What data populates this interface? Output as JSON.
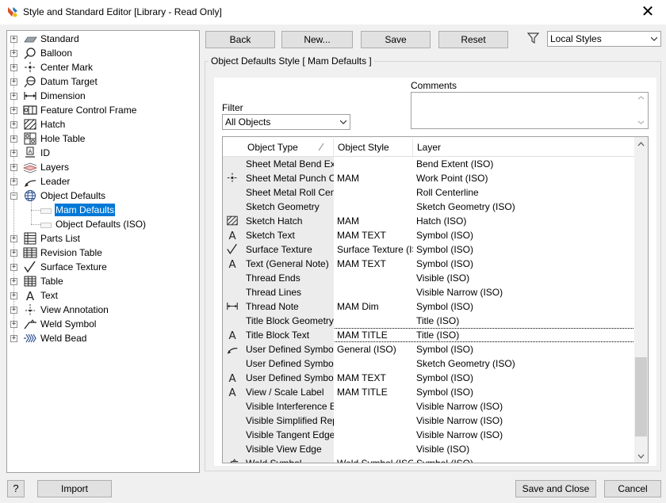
{
  "window": {
    "title": "Style and Standard Editor [Library - Read Only]",
    "close_glyph": "✕"
  },
  "tree": {
    "items": [
      {
        "label": "Standard",
        "icon": "standard-icon"
      },
      {
        "label": "Balloon",
        "icon": "balloon-icon"
      },
      {
        "label": "Center Mark",
        "icon": "center-mark-icon"
      },
      {
        "label": "Datum Target",
        "icon": "datum-target-icon"
      },
      {
        "label": "Dimension",
        "icon": "dimension-icon"
      },
      {
        "label": "Feature Control Frame",
        "icon": "feature-control-frame-icon"
      },
      {
        "label": "Hatch",
        "icon": "hatch-icon"
      },
      {
        "label": "Hole Table",
        "icon": "hole-table-icon"
      },
      {
        "label": "ID",
        "icon": "id-icon"
      },
      {
        "label": "Layers",
        "icon": "layers-icon"
      },
      {
        "label": "Leader",
        "icon": "leader-icon"
      },
      {
        "label": "Object Defaults",
        "icon": "object-defaults-icon"
      },
      {
        "label": "Parts List",
        "icon": "parts-list-icon"
      },
      {
        "label": "Revision Table",
        "icon": "revision-table-icon"
      },
      {
        "label": "Surface Texture",
        "icon": "surface-texture-icon"
      },
      {
        "label": "Table",
        "icon": "table-icon"
      },
      {
        "label": "Text",
        "icon": "text-icon"
      },
      {
        "label": "View Annotation",
        "icon": "view-annotation-icon"
      },
      {
        "label": "Weld Symbol",
        "icon": "weld-symbol-icon"
      },
      {
        "label": "Weld Bead",
        "icon": "weld-bead-icon"
      }
    ],
    "object_defaults_children": [
      "Mam Defaults",
      "Object Defaults (ISO)"
    ],
    "selected_child": "Mam Defaults"
  },
  "toolbar": {
    "back": "Back",
    "new": "New...",
    "save": "Save",
    "reset": "Reset",
    "filter_icon": "funnel-icon",
    "styles_filter": "Local Styles"
  },
  "group": {
    "title": "Object Defaults Style [ Mam Defaults ]"
  },
  "comments_label": "Comments",
  "filter": {
    "label": "Filter",
    "value": "All Objects"
  },
  "grid": {
    "columns": [
      "Object Type",
      "Object Style",
      "Layer"
    ],
    "rows": [
      {
        "icon": "",
        "type": "Sheet Metal Bend Extents",
        "style": "",
        "layer": "Bend Extent (ISO)"
      },
      {
        "icon": "center-mark-icon",
        "type": "Sheet Metal Punch Center",
        "style": "MAM",
        "layer": "Work Point (ISO)"
      },
      {
        "icon": "",
        "type": "Sheet Metal Roll Centerline",
        "style": "",
        "layer": "Roll Centerline"
      },
      {
        "icon": "",
        "type": "Sketch Geometry",
        "style": "",
        "layer": "Sketch Geometry (ISO)"
      },
      {
        "icon": "hatch-icon",
        "type": "Sketch Hatch",
        "style": "MAM",
        "layer": "Hatch (ISO)"
      },
      {
        "icon": "text-icon",
        "type": "Sketch Text",
        "style": "MAM TEXT",
        "layer": "Symbol (ISO)"
      },
      {
        "icon": "surface-texture-icon",
        "type": "Surface Texture",
        "style": "Surface Texture (ISO)",
        "layer": "Symbol (ISO)"
      },
      {
        "icon": "text-icon",
        "type": "Text (General Note)",
        "style": "MAM TEXT",
        "layer": "Symbol (ISO)"
      },
      {
        "icon": "",
        "type": "Thread Ends",
        "style": "",
        "layer": "Visible (ISO)"
      },
      {
        "icon": "",
        "type": "Thread Lines",
        "style": "",
        "layer": "Visible Narrow (ISO)"
      },
      {
        "icon": "dimension-icon",
        "type": "Thread Note",
        "style": "MAM Dim",
        "layer": "Symbol (ISO)"
      },
      {
        "icon": "",
        "type": "Title Block Geometry",
        "style": "",
        "layer": "Title (ISO)"
      },
      {
        "icon": "text-icon",
        "type": "Title Block Text",
        "style": "MAM TITLE",
        "layer": "Title (ISO)"
      },
      {
        "icon": "leader-icon",
        "type": "User Defined Symbol (Leader)",
        "style": "General (ISO)",
        "layer": "Symbol (ISO)"
      },
      {
        "icon": "",
        "type": "User Defined Symbol Geometry",
        "style": "",
        "layer": "Sketch Geometry (ISO)"
      },
      {
        "icon": "text-icon",
        "type": "User Defined Symbol Text",
        "style": "MAM TEXT",
        "layer": "Symbol (ISO)"
      },
      {
        "icon": "text-icon",
        "type": "View / Scale Label",
        "style": "MAM TITLE",
        "layer": "Symbol (ISO)"
      },
      {
        "icon": "",
        "type": "Visible Interference Edges",
        "style": "",
        "layer": "Visible Narrow (ISO)"
      },
      {
        "icon": "",
        "type": "Visible Simplified Representation",
        "style": "",
        "layer": "Visible Narrow (ISO)"
      },
      {
        "icon": "",
        "type": "Visible Tangent Edge",
        "style": "",
        "layer": "Visible Narrow (ISO)"
      },
      {
        "icon": "",
        "type": "Visible View Edge",
        "style": "",
        "layer": "Visible (ISO)"
      },
      {
        "icon": "weld-symbol-icon",
        "type": "Weld Symbol",
        "style": "Weld Symbol (ISO)",
        "layer": "Symbol (ISO)"
      }
    ],
    "focused_row_type": "Title Block Text"
  },
  "footer": {
    "help": "?",
    "import": "Import",
    "save_close": "Save and Close",
    "cancel": "Cancel"
  }
}
